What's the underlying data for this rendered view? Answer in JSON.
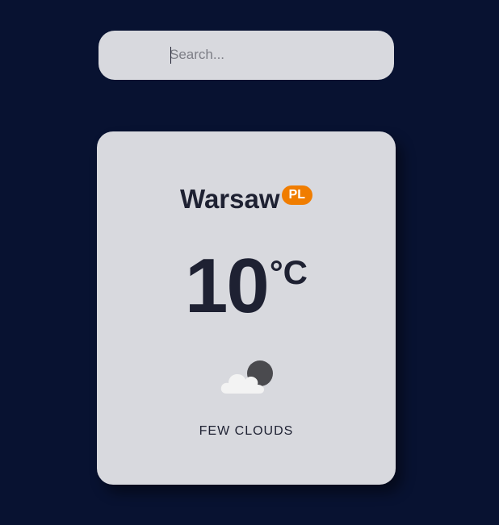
{
  "search": {
    "placeholder": "Search...",
    "value": ""
  },
  "weather": {
    "city": "Warsaw",
    "country_code": "PL",
    "temperature": "10",
    "unit": "°C",
    "icon": "few-clouds-night-icon",
    "description": "FEW CLOUDS"
  },
  "colors": {
    "background": "#081231",
    "card": "#d8d9de",
    "text": "#1e2132",
    "badge": "#f07d00"
  }
}
